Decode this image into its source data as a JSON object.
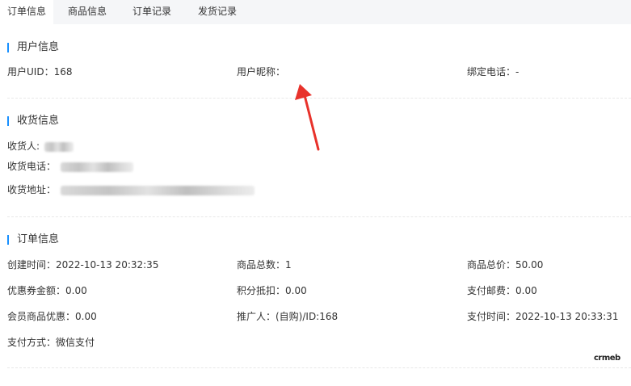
{
  "tabs": [
    {
      "label": "订单信息",
      "active": true
    },
    {
      "label": "商品信息",
      "active": false
    },
    {
      "label": "订单记录",
      "active": false
    },
    {
      "label": "发货记录",
      "active": false
    }
  ],
  "sections": {
    "user": {
      "title": "用户信息",
      "uid": "用户UID：168",
      "nickname": "用户昵称：",
      "phone": "绑定电话：-"
    },
    "shipping": {
      "title": "收货信息",
      "receiver": "收货人:",
      "phone": "收货电话：",
      "address": "收货地址："
    },
    "order": {
      "title": "订单信息",
      "create_time": "创建时间：2022-10-13 20:32:35",
      "total_count": "商品总数：1",
      "total_price": "商品总价：50.00",
      "coupon": "优惠券金额：0.00",
      "points": "积分抵扣：0.00",
      "postage": "支付邮费：0.00",
      "member_discount": "会员商品优惠：0.00",
      "promoter": "推广人：(自购)/ID:168",
      "pay_time": "支付时间：2022-10-13 20:33:31",
      "pay_method": "支付方式：微信支付"
    }
  },
  "logo": "crmeb",
  "colors": {
    "accent": "#1890ff",
    "arrow": "#e8322b",
    "tab_bg": "#f5f6f8"
  }
}
